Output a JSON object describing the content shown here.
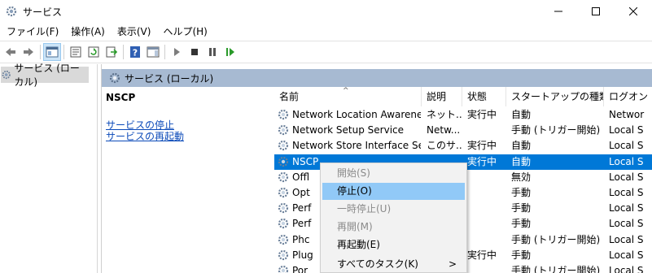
{
  "window": {
    "title": "サービス"
  },
  "menubar": [
    {
      "label": "ファイル(F)"
    },
    {
      "label": "操作(A)"
    },
    {
      "label": "表示(V)"
    },
    {
      "label": "ヘルプ(H)"
    }
  ],
  "tree": {
    "item": "サービス (ローカル)"
  },
  "content": {
    "header": "サービス (ローカル)",
    "selected_service": "NSCP",
    "links": [
      "サービスの停止",
      "サービスの再起動"
    ]
  },
  "table": {
    "columns": [
      "名前",
      "説明",
      "状態",
      "スタートアップの種類",
      "ログオン"
    ],
    "rows": [
      {
        "name": "Network Location Awareness",
        "desc": "ネット...",
        "status": "実行中",
        "startup": "自動",
        "logon": "Networ"
      },
      {
        "name": "Network Setup Service",
        "desc": "Netw...",
        "status": "",
        "startup": "手動 (トリガー開始)",
        "logon": "Local S"
      },
      {
        "name": "Network Store Interface Ser...",
        "desc": "このサ...",
        "status": "実行中",
        "startup": "自動",
        "logon": "Local S"
      },
      {
        "name": "NSCP",
        "desc": "",
        "status": "実行中",
        "startup": "自動",
        "logon": "Local S",
        "selected": true
      },
      {
        "name": "Offl",
        "desc": "",
        "status": "",
        "startup": "無効",
        "logon": "Local S"
      },
      {
        "name": "Opt",
        "desc": "",
        "status": "",
        "startup": "手動",
        "logon": "Local S"
      },
      {
        "name": "Perf",
        "desc": "",
        "status": "",
        "startup": "手動",
        "logon": "Local S"
      },
      {
        "name": "Perf",
        "desc": "",
        "status": "",
        "startup": "手動",
        "logon": "Local S"
      },
      {
        "name": "Phc",
        "desc": "",
        "status": "",
        "startup": "手動 (トリガー開始)",
        "logon": "Local S"
      },
      {
        "name": "Plug",
        "desc": "",
        "status": "実行中",
        "startup": "手動",
        "logon": "Local S"
      },
      {
        "name": "Por",
        "desc": "",
        "status": "",
        "startup": "手動 (トリガー開始)",
        "logon": "Local S"
      }
    ]
  },
  "context_menu": [
    {
      "label": "開始(S)",
      "disabled": true
    },
    {
      "label": "停止(O)",
      "hover": true
    },
    {
      "label": "一時停止(U)",
      "disabled": true
    },
    {
      "label": "再開(M)",
      "disabled": true
    },
    {
      "label": "再起動(E)"
    },
    {
      "label": "すべてのタスク(K)",
      "submenu": ">"
    }
  ],
  "colors": {
    "selection": "#0078d7",
    "header_band": "#a7bad2",
    "menu_hover": "#91c9f7",
    "link": "#0b4ab9"
  }
}
